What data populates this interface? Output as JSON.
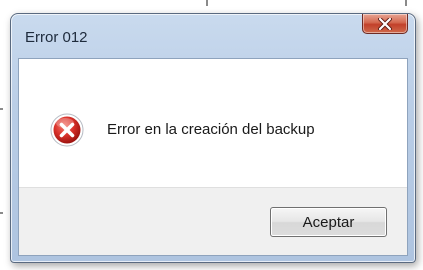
{
  "dialog": {
    "title": "Error 012",
    "message": "Error en la creación del backup",
    "accept_label": "Aceptar"
  },
  "icons": {
    "close": "close-icon",
    "status": "error-icon"
  },
  "colors": {
    "error_red": "#d32f2f",
    "close_button": "#c2402a",
    "title_bar": "#b9cde6"
  }
}
